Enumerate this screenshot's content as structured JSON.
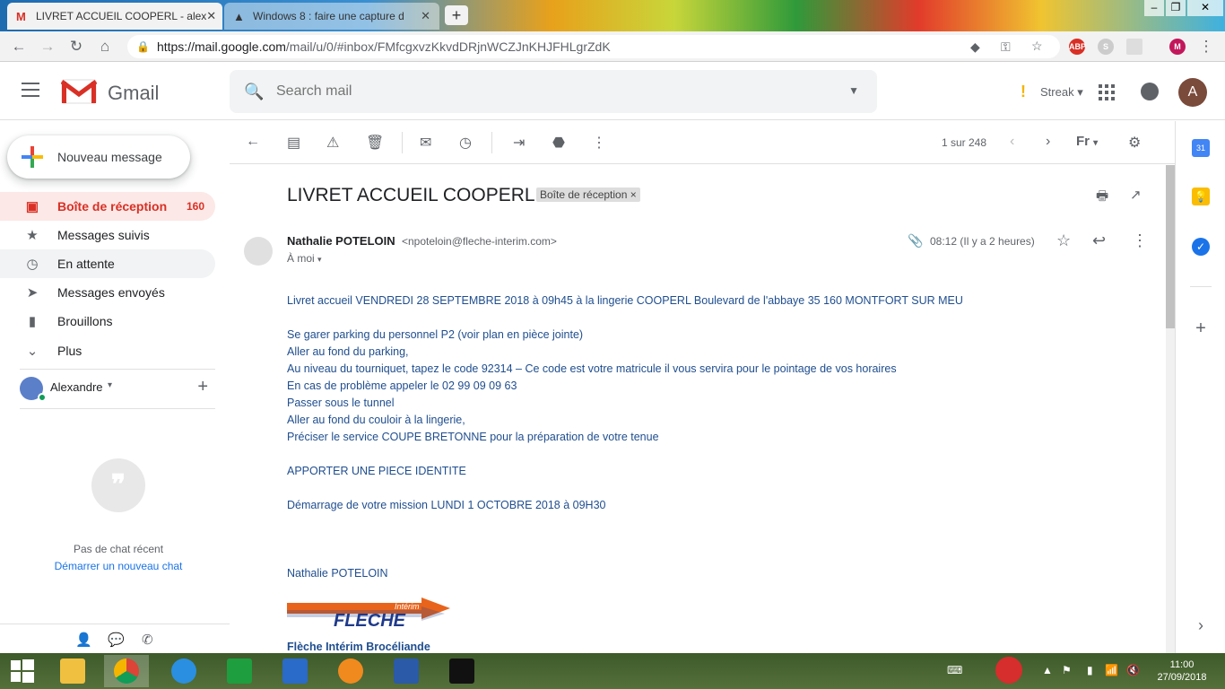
{
  "browser": {
    "tabs": [
      {
        "title": "LIVRET ACCUEIL COOPERL - alex",
        "active": true
      },
      {
        "title": "Windows 8 : faire une capture d",
        "active": false
      }
    ],
    "url_host": "https://mail.google.com",
    "url_path": "/mail/u/0/#inbox/FMfcgxvzKkvdDRjnWCZJnKHJFHLgrZdK",
    "extensions": [
      "ABP",
      "S",
      "M"
    ]
  },
  "header": {
    "app_name": "Gmail",
    "search_placeholder": "Search mail",
    "streak_label": "Streak",
    "avatar_letter": "A"
  },
  "sidebar": {
    "compose_label": "Nouveau message",
    "items": [
      {
        "label": "Boîte de réception",
        "count": "160",
        "icon": "inbox-icon"
      },
      {
        "label": "Messages suivis",
        "count": "",
        "icon": "star-icon"
      },
      {
        "label": "En attente",
        "count": "",
        "icon": "clock-icon"
      },
      {
        "label": "Messages envoyés",
        "count": "",
        "icon": "send-icon"
      },
      {
        "label": "Brouillons",
        "count": "",
        "icon": "draft-icon"
      },
      {
        "label": "Plus",
        "count": "",
        "icon": "chevron-down-icon"
      }
    ],
    "user_name": "Alexandre",
    "no_chat": "Pas de chat récent",
    "start_chat": "Démarrer un nouveau chat"
  },
  "toolbar": {
    "pager": "1 sur 248",
    "lang": "Fr"
  },
  "email": {
    "subject": "LIVRET ACCUEIL COOPERL",
    "label_chip": "Boîte de réception",
    "sender_name": "Nathalie POTELOIN",
    "sender_email": "<npoteloin@fleche-interim.com>",
    "to": "À moi",
    "time": "08:12 (Il y a 2 heures)",
    "body": [
      "Livret accueil VENDREDI 28 SEPTEMBRE  2018 à 09h45 à la lingerie COOPERL Boulevard de l'abbaye 35 160 MONTFORT SUR MEU",
      "Se garer parking du personnel P2 (voir plan en pièce jointe)",
      "Aller au fond du parking,",
      "Au niveau du tourniquet, tapez le code 92314 – Ce code est votre matricule il vous servira pour le pointage de vos horaires",
      "En cas de problème appeler  le  02 99 09 09 63",
      "Passer sous le tunnel",
      "Aller au fond du couloir à  la lingerie,",
      "Préciser le service COUPE BRETONNE pour la préparation de votre tenue",
      "APPORTER UNE PIECE IDENTITE",
      "Démarrage de votre mission LUNDI 1 OCTOBRE 2018 à 09H30",
      "Nathalie POTELOIN"
    ],
    "logo_text": "FLECHE",
    "logo_subtext": "Intérim",
    "signature_company": "Flèche Intérim Brocéliande"
  },
  "taskbar": {
    "time": "11:00",
    "date": "27/09/2018"
  },
  "colors": {
    "accent_red": "#d93025",
    "body_blue": "#1f4e8f",
    "link_blue": "#1a73e8"
  }
}
